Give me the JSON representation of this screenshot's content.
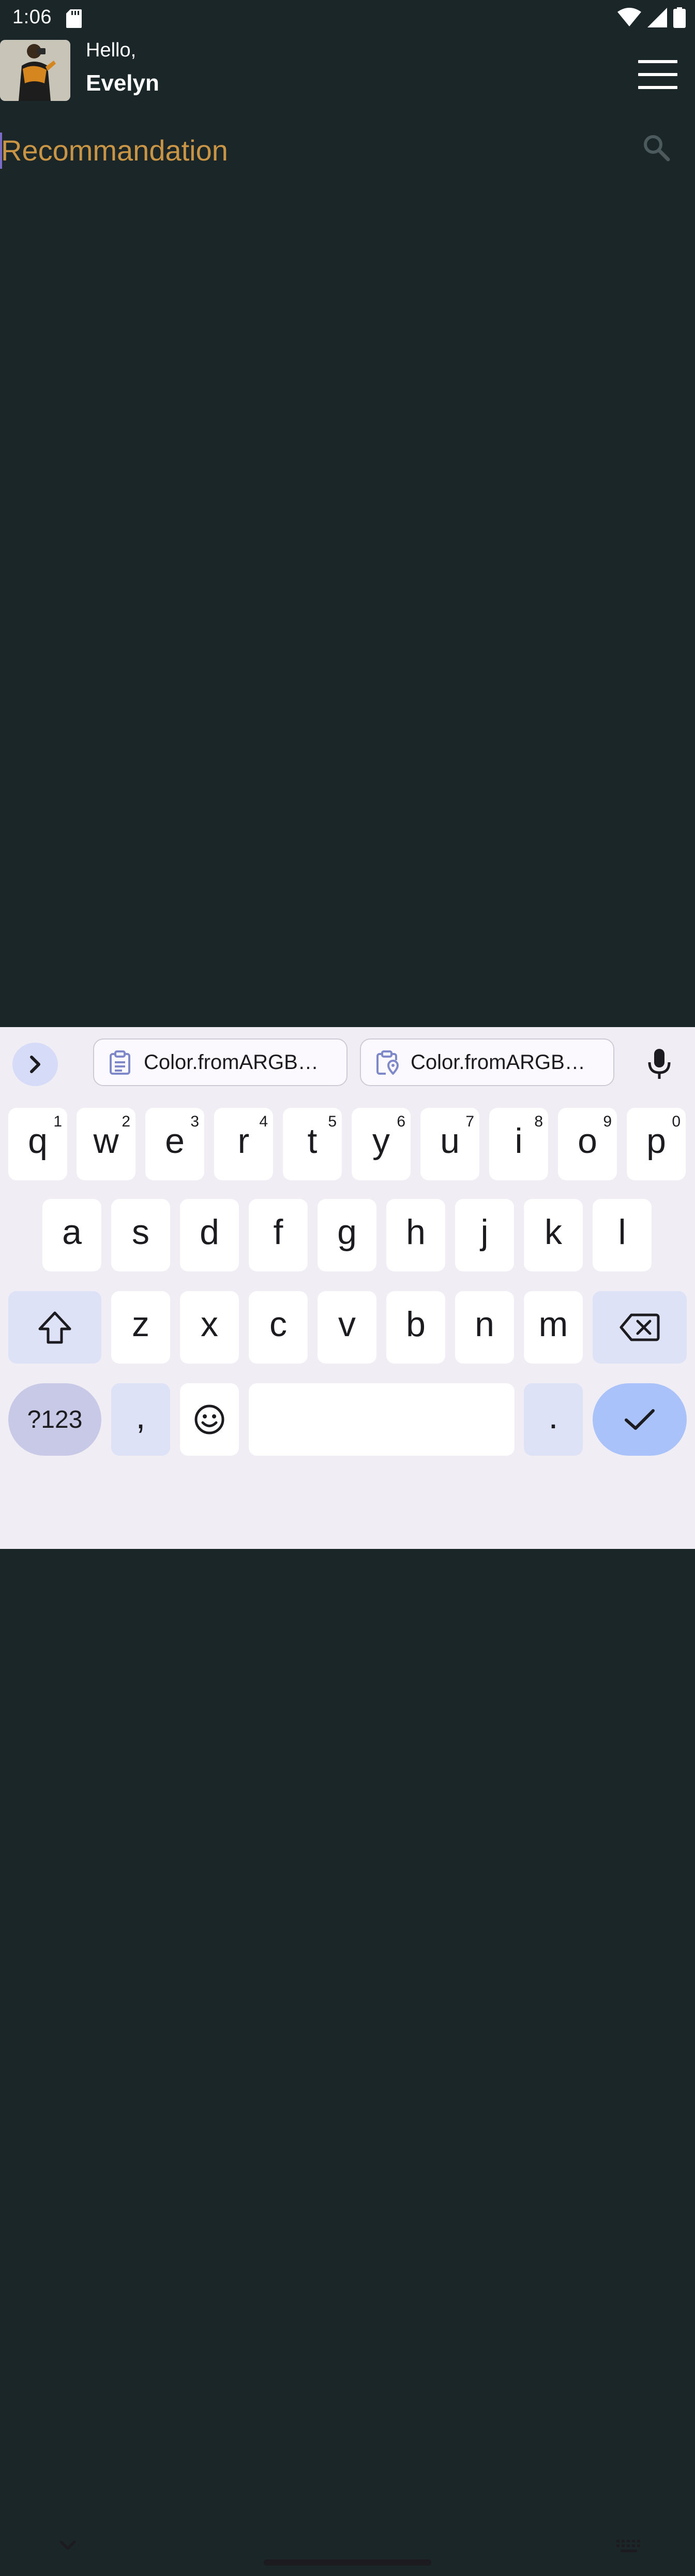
{
  "status_bar": {
    "time": "1:06",
    "icons": [
      "sd-card-icon",
      "wifi-icon",
      "cell-signal-icon",
      "battery-icon"
    ]
  },
  "header": {
    "greeting": "Hello,",
    "user_name": "Evelyn",
    "avatar_icon": "user-avatar",
    "menu_icon": "hamburger-menu-icon"
  },
  "search": {
    "value": "Recommandation",
    "icon": "search-icon",
    "text_color": "#c99545"
  },
  "keyboard": {
    "clipboard_suggestions": [
      {
        "text": "Color.fromARGB…",
        "icon": "clipboard-icon"
      },
      {
        "text": "Color.fromARGB…",
        "icon": "clipboard-location-icon"
      }
    ],
    "row1": [
      {
        "ch": "q",
        "hint": "1"
      },
      {
        "ch": "w",
        "hint": "2"
      },
      {
        "ch": "e",
        "hint": "3"
      },
      {
        "ch": "r",
        "hint": "4"
      },
      {
        "ch": "t",
        "hint": "5"
      },
      {
        "ch": "y",
        "hint": "6"
      },
      {
        "ch": "u",
        "hint": "7"
      },
      {
        "ch": "i",
        "hint": "8"
      },
      {
        "ch": "o",
        "hint": "9"
      },
      {
        "ch": "p",
        "hint": "0"
      }
    ],
    "row2": [
      "a",
      "s",
      "d",
      "f",
      "g",
      "h",
      "j",
      "k",
      "l"
    ],
    "row3": [
      "z",
      "x",
      "c",
      "v",
      "b",
      "n",
      "m"
    ],
    "symbols_label": "?123",
    "comma_label": ",",
    "period_label": ".",
    "accent_color": "#a9c2f9"
  },
  "colors": {
    "background": "#1a2628",
    "keyboard_background": "#f0edf5",
    "caret": "#7b6cc8"
  }
}
